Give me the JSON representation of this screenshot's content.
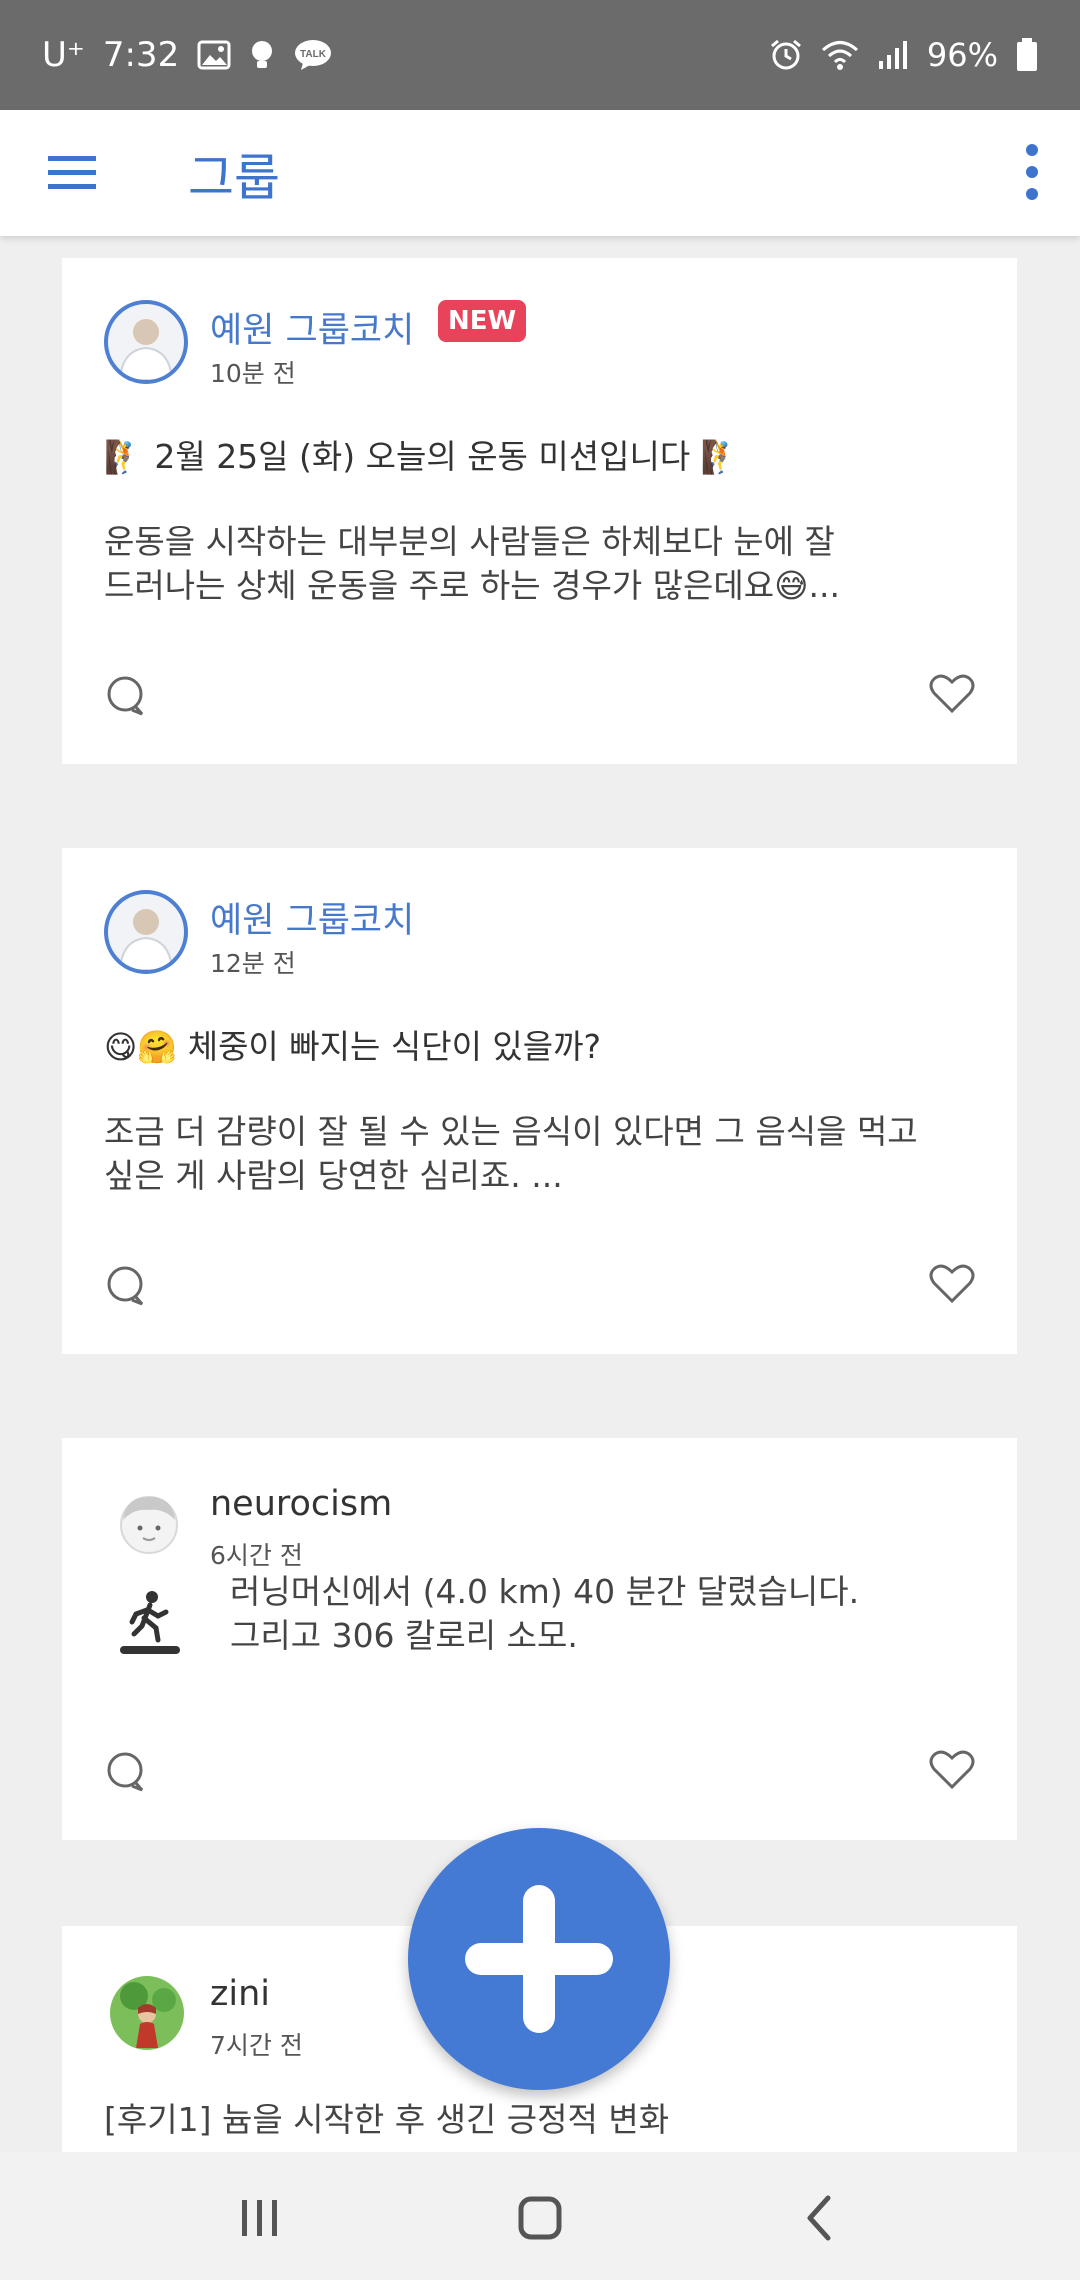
{
  "status_bar": {
    "carrier": "U⁺",
    "time": "7:32",
    "battery": "96%",
    "left_icons": [
      "gallery-icon",
      "bulb-icon",
      "kakaotalk-icon"
    ],
    "kakaotalk_label": "TALK",
    "right_icons": [
      "alarm-icon",
      "wifi-icon",
      "signal-icon",
      "battery-icon"
    ]
  },
  "app_bar": {
    "title": "그룹",
    "menu_icon": "hamburger-menu-icon",
    "overflow_icon": "more-vert-icon",
    "accent_color": "#3f74cc"
  },
  "feed": [
    {
      "author": "예원 그룹코치",
      "badge": "NEW",
      "time": "10분 전",
      "headline_text": "2월 25일 (화) 오늘의 운동 미션입니다",
      "headline_emoji": "🧗",
      "excerpt_lines": [
        "운동을 시작하는 대부분의 사람들은 하체보다 눈에 잘",
        "드러나는 상체 운동을 주로 하는 경우가 많은데요😅..."
      ]
    },
    {
      "author": "예원 그룹코치",
      "time": "12분 전",
      "headline_emoji": "😋🤗",
      "headline_text": "체중이 빠지는 식단이 있을까?",
      "excerpt_lines": [
        "조금 더 감량이 잘 될 수 있는 음식이 있다면 그 음식을 먹고",
        "싶은 게 사람의 당연한 심리죠. ..."
      ]
    },
    {
      "author": "neurocism",
      "time": "6시간 전",
      "activity_icon": "treadmill-running-icon",
      "activity_lines": [
        "러닝머신에서 (4.0 km) 40 분간 달렸습니다.",
        "그리고 306 칼로리 소모."
      ]
    },
    {
      "author": "zini",
      "time": "7시간 전",
      "excerpt_lines": [
        "[후기1] 늄을 시작한 후 생긴 긍정적 변화"
      ]
    }
  ],
  "fab": {
    "icon": "plus-icon",
    "color": "#4479d4"
  },
  "badge_color": "#e8435a",
  "nav_bar": {
    "icons": [
      "recent-apps-icon",
      "home-icon",
      "back-icon"
    ]
  }
}
